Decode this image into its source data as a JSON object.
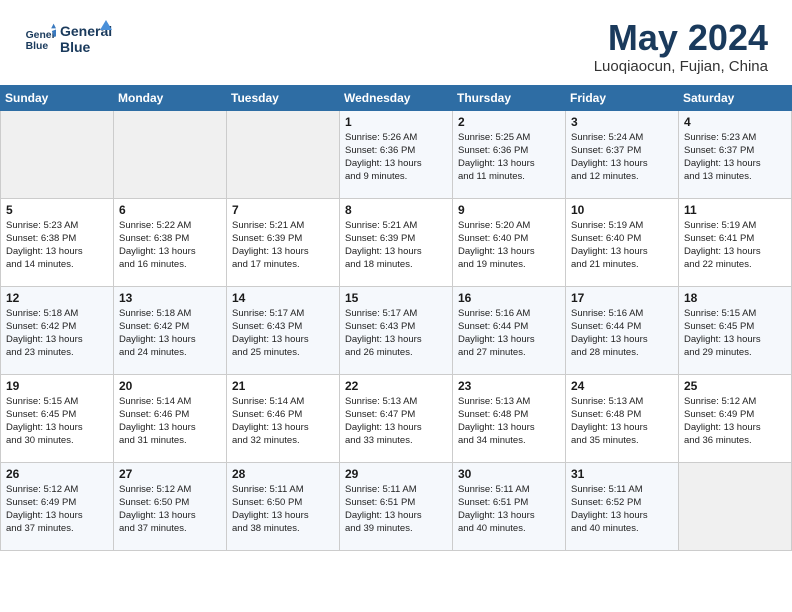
{
  "header": {
    "logo_line1": "General",
    "logo_line2": "Blue",
    "title": "May 2024",
    "subtitle": "Luoqiaocun, Fujian, China"
  },
  "weekdays": [
    "Sunday",
    "Monday",
    "Tuesday",
    "Wednesday",
    "Thursday",
    "Friday",
    "Saturday"
  ],
  "weeks": [
    [
      {
        "day": "",
        "info": ""
      },
      {
        "day": "",
        "info": ""
      },
      {
        "day": "",
        "info": ""
      },
      {
        "day": "1",
        "info": "Sunrise: 5:26 AM\nSunset: 6:36 PM\nDaylight: 13 hours\nand 9 minutes."
      },
      {
        "day": "2",
        "info": "Sunrise: 5:25 AM\nSunset: 6:36 PM\nDaylight: 13 hours\nand 11 minutes."
      },
      {
        "day": "3",
        "info": "Sunrise: 5:24 AM\nSunset: 6:37 PM\nDaylight: 13 hours\nand 12 minutes."
      },
      {
        "day": "4",
        "info": "Sunrise: 5:23 AM\nSunset: 6:37 PM\nDaylight: 13 hours\nand 13 minutes."
      }
    ],
    [
      {
        "day": "5",
        "info": "Sunrise: 5:23 AM\nSunset: 6:38 PM\nDaylight: 13 hours\nand 14 minutes."
      },
      {
        "day": "6",
        "info": "Sunrise: 5:22 AM\nSunset: 6:38 PM\nDaylight: 13 hours\nand 16 minutes."
      },
      {
        "day": "7",
        "info": "Sunrise: 5:21 AM\nSunset: 6:39 PM\nDaylight: 13 hours\nand 17 minutes."
      },
      {
        "day": "8",
        "info": "Sunrise: 5:21 AM\nSunset: 6:39 PM\nDaylight: 13 hours\nand 18 minutes."
      },
      {
        "day": "9",
        "info": "Sunrise: 5:20 AM\nSunset: 6:40 PM\nDaylight: 13 hours\nand 19 minutes."
      },
      {
        "day": "10",
        "info": "Sunrise: 5:19 AM\nSunset: 6:40 PM\nDaylight: 13 hours\nand 21 minutes."
      },
      {
        "day": "11",
        "info": "Sunrise: 5:19 AM\nSunset: 6:41 PM\nDaylight: 13 hours\nand 22 minutes."
      }
    ],
    [
      {
        "day": "12",
        "info": "Sunrise: 5:18 AM\nSunset: 6:42 PM\nDaylight: 13 hours\nand 23 minutes."
      },
      {
        "day": "13",
        "info": "Sunrise: 5:18 AM\nSunset: 6:42 PM\nDaylight: 13 hours\nand 24 minutes."
      },
      {
        "day": "14",
        "info": "Sunrise: 5:17 AM\nSunset: 6:43 PM\nDaylight: 13 hours\nand 25 minutes."
      },
      {
        "day": "15",
        "info": "Sunrise: 5:17 AM\nSunset: 6:43 PM\nDaylight: 13 hours\nand 26 minutes."
      },
      {
        "day": "16",
        "info": "Sunrise: 5:16 AM\nSunset: 6:44 PM\nDaylight: 13 hours\nand 27 minutes."
      },
      {
        "day": "17",
        "info": "Sunrise: 5:16 AM\nSunset: 6:44 PM\nDaylight: 13 hours\nand 28 minutes."
      },
      {
        "day": "18",
        "info": "Sunrise: 5:15 AM\nSunset: 6:45 PM\nDaylight: 13 hours\nand 29 minutes."
      }
    ],
    [
      {
        "day": "19",
        "info": "Sunrise: 5:15 AM\nSunset: 6:45 PM\nDaylight: 13 hours\nand 30 minutes."
      },
      {
        "day": "20",
        "info": "Sunrise: 5:14 AM\nSunset: 6:46 PM\nDaylight: 13 hours\nand 31 minutes."
      },
      {
        "day": "21",
        "info": "Sunrise: 5:14 AM\nSunset: 6:46 PM\nDaylight: 13 hours\nand 32 minutes."
      },
      {
        "day": "22",
        "info": "Sunrise: 5:13 AM\nSunset: 6:47 PM\nDaylight: 13 hours\nand 33 minutes."
      },
      {
        "day": "23",
        "info": "Sunrise: 5:13 AM\nSunset: 6:48 PM\nDaylight: 13 hours\nand 34 minutes."
      },
      {
        "day": "24",
        "info": "Sunrise: 5:13 AM\nSunset: 6:48 PM\nDaylight: 13 hours\nand 35 minutes."
      },
      {
        "day": "25",
        "info": "Sunrise: 5:12 AM\nSunset: 6:49 PM\nDaylight: 13 hours\nand 36 minutes."
      }
    ],
    [
      {
        "day": "26",
        "info": "Sunrise: 5:12 AM\nSunset: 6:49 PM\nDaylight: 13 hours\nand 37 minutes."
      },
      {
        "day": "27",
        "info": "Sunrise: 5:12 AM\nSunset: 6:50 PM\nDaylight: 13 hours\nand 37 minutes."
      },
      {
        "day": "28",
        "info": "Sunrise: 5:11 AM\nSunset: 6:50 PM\nDaylight: 13 hours\nand 38 minutes."
      },
      {
        "day": "29",
        "info": "Sunrise: 5:11 AM\nSunset: 6:51 PM\nDaylight: 13 hours\nand 39 minutes."
      },
      {
        "day": "30",
        "info": "Sunrise: 5:11 AM\nSunset: 6:51 PM\nDaylight: 13 hours\nand 40 minutes."
      },
      {
        "day": "31",
        "info": "Sunrise: 5:11 AM\nSunset: 6:52 PM\nDaylight: 13 hours\nand 40 minutes."
      },
      {
        "day": "",
        "info": ""
      }
    ]
  ]
}
